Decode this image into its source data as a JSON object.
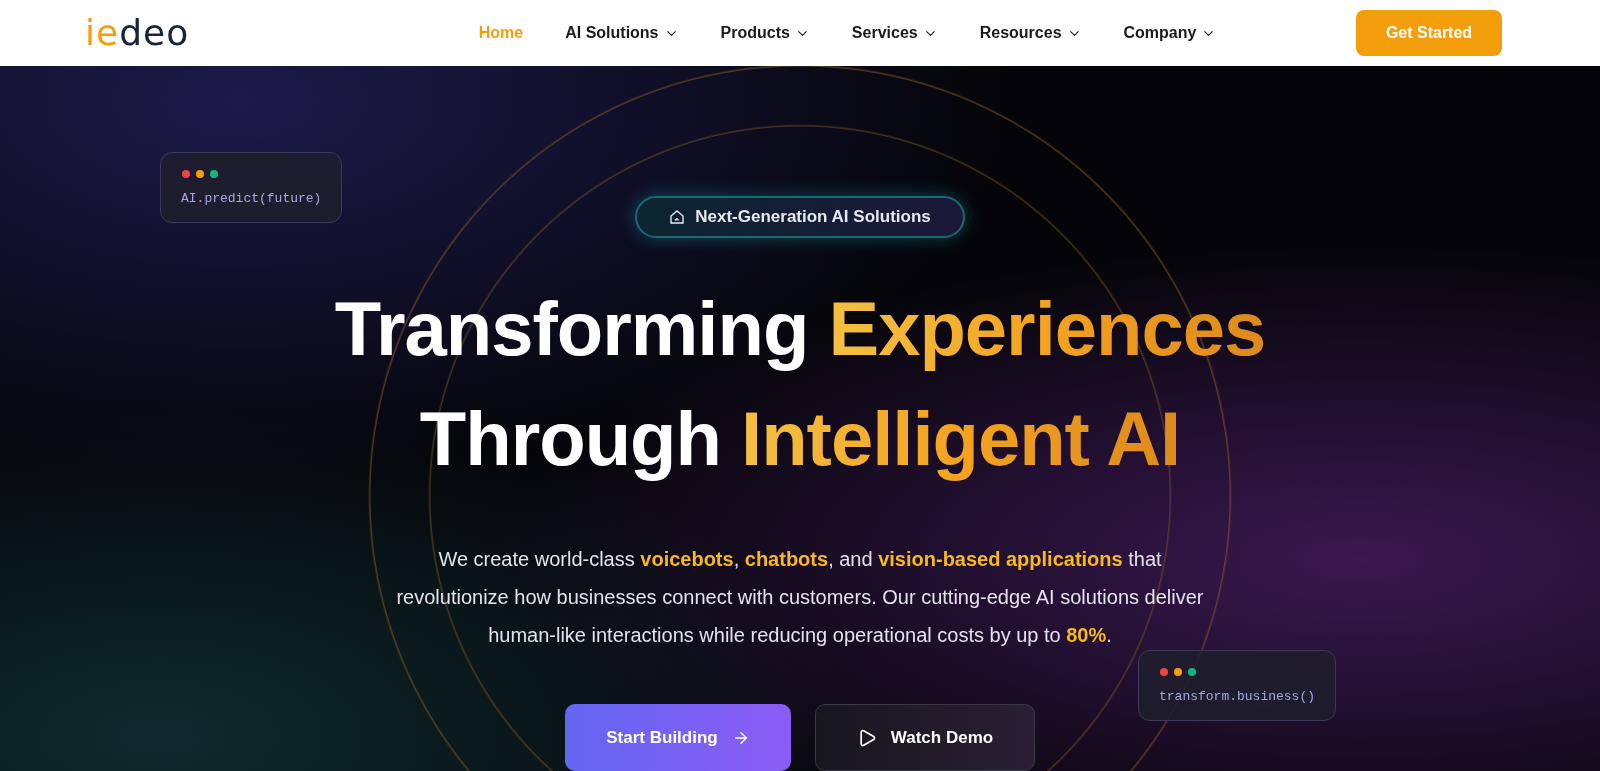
{
  "logo": {
    "accent": "ie",
    "rest": "deo"
  },
  "nav": [
    {
      "label": "Home",
      "selected": true,
      "dropdown": false
    },
    {
      "label": "AI Solutions",
      "selected": false,
      "dropdown": true
    },
    {
      "label": "Products",
      "selected": false,
      "dropdown": true
    },
    {
      "label": "Services",
      "selected": false,
      "dropdown": true
    },
    {
      "label": "Resources",
      "selected": false,
      "dropdown": true
    },
    {
      "label": "Company",
      "selected": false,
      "dropdown": true
    }
  ],
  "cta": "Get Started",
  "code_cards": [
    "AI.predict(future)",
    "transform.business()"
  ],
  "badge": "Next-Generation AI Solutions",
  "headline": [
    [
      {
        "text": "Transforming",
        "highlight": false
      },
      {
        "text": "Experiences",
        "highlight": true
      }
    ],
    [
      {
        "text": "Through",
        "highlight": false
      },
      {
        "text": "Intelligent AI",
        "highlight": true
      }
    ]
  ],
  "intro": [
    {
      "text": "We create world-class ",
      "highlight": false
    },
    {
      "text": "voicebots",
      "highlight": true
    },
    {
      "text": ", ",
      "highlight": false
    },
    {
      "text": "chatbots",
      "highlight": true
    },
    {
      "text": ", and ",
      "highlight": false
    },
    {
      "text": "vision-based applications",
      "highlight": true
    },
    {
      "text": " that revolutionize how businesses connect with customers. Our cutting-edge AI solutions deliver human-like interactions while reducing operational costs by up to ",
      "highlight": false
    },
    {
      "text": "80%",
      "highlight": true
    },
    {
      "text": ".",
      "highlight": false
    }
  ],
  "buttons": [
    {
      "label": "Start Building",
      "kind": "primary"
    },
    {
      "label": "Watch Demo",
      "kind": "secondary"
    }
  ]
}
